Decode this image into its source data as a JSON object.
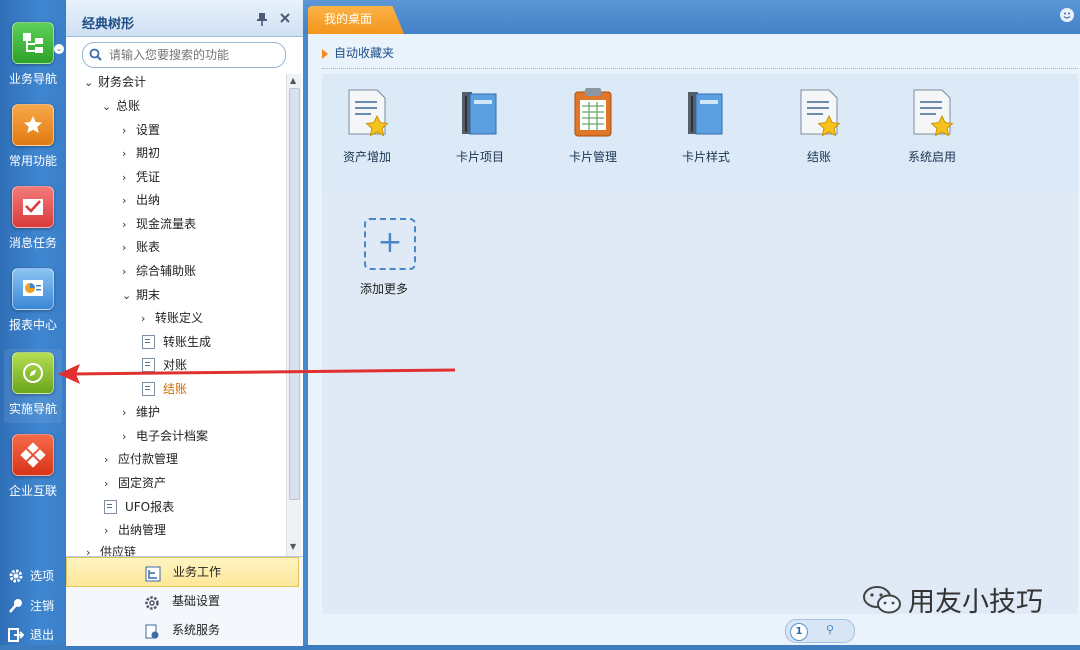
{
  "leftnav": {
    "items": [
      {
        "label": "业务导航",
        "icon": "business-nav-icon"
      },
      {
        "label": "常用功能",
        "icon": "favorite-functions-icon"
      },
      {
        "label": "消息任务",
        "icon": "message-task-icon"
      },
      {
        "label": "报表中心",
        "icon": "report-center-icon"
      },
      {
        "label": "实施导航",
        "icon": "implementation-nav-icon"
      },
      {
        "label": "企业互联",
        "icon": "enterprise-connect-icon"
      }
    ],
    "bottom": [
      {
        "label": "选项",
        "icon": "gear-icon"
      },
      {
        "label": "注销",
        "icon": "key-icon"
      },
      {
        "label": "退出",
        "icon": "exit-icon"
      }
    ]
  },
  "tree": {
    "title": "经典树形",
    "search_placeholder": "请输入您要搜索的功能",
    "nodes": [
      {
        "label": "财务会计"
      },
      {
        "label": "总账"
      },
      {
        "label": "设置"
      },
      {
        "label": "期初"
      },
      {
        "label": "凭证"
      },
      {
        "label": "出纳"
      },
      {
        "label": "现金流量表"
      },
      {
        "label": "账表"
      },
      {
        "label": "综合辅助账"
      },
      {
        "label": "期末"
      },
      {
        "label": "转账定义"
      },
      {
        "label": "转账生成"
      },
      {
        "label": "对账"
      },
      {
        "label": "结账"
      },
      {
        "label": "维护"
      },
      {
        "label": "电子会计档案"
      },
      {
        "label": "应付款管理"
      },
      {
        "label": "固定资产"
      },
      {
        "label": "UFO报表"
      },
      {
        "label": "出纳管理"
      },
      {
        "label": "供应链"
      }
    ],
    "footer": [
      {
        "label": "业务工作",
        "active": true
      },
      {
        "label": "基础设置",
        "active": false
      },
      {
        "label": "系统服务",
        "active": false
      }
    ]
  },
  "main": {
    "tab_label": "我的桌面",
    "favorites_header": "自动收藏夹",
    "favorites": [
      {
        "label": "资产增加",
        "icon": "doc-star-icon"
      },
      {
        "label": "卡片项目",
        "icon": "card-book-icon"
      },
      {
        "label": "卡片管理",
        "icon": "clipboard-icon"
      },
      {
        "label": "卡片样式",
        "icon": "card-book-icon"
      },
      {
        "label": "结账",
        "icon": "doc-star-icon"
      },
      {
        "label": "系统启用",
        "icon": "doc-star-icon"
      }
    ],
    "add_more_label": "添加更多",
    "pager_current": "1"
  },
  "watermark": "用友小技巧",
  "colors": {
    "accent_orange": "#f39a1f",
    "nav_blue": "#3a7ec8",
    "arrow_red": "#e03030"
  }
}
